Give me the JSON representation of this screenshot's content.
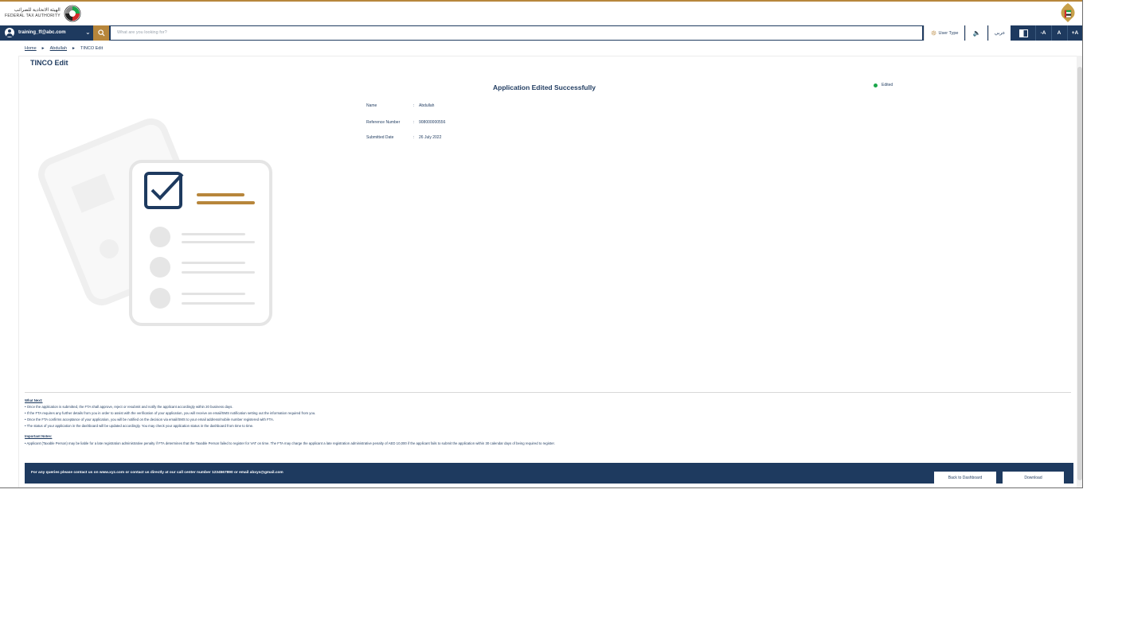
{
  "header": {
    "logo_text_ar": "الهيئة الاتحادية للضرائب",
    "logo_text_en": "FEDERAL TAX AUTHORITY"
  },
  "navbar": {
    "user_email": "training_ff@abc.com",
    "search_placeholder": "What are you looking for?",
    "user_type_label": "User Type",
    "language_label": "عربي",
    "font_decrease": "-A",
    "font_normal": "A",
    "font_increase": "+A"
  },
  "breadcrumb": {
    "items": [
      "Home",
      "Abdullah",
      "TINCO Edit"
    ]
  },
  "page": {
    "title": "TINCO Edit",
    "success_message": "Application Edited Successfully",
    "status_label": "Edited",
    "status_color": "#1aa64a"
  },
  "details": [
    {
      "label": "Name",
      "value": "Abdullah"
    },
    {
      "label": "Reference Number",
      "value": "908000000556"
    },
    {
      "label": "Submitted Date",
      "value": "26 July 2022"
    }
  ],
  "notes": {
    "what_next_heading": "What Next:",
    "what_next": [
      "• Once the application is submitted, the FTA shall approve, reject or resubmit and notify the applicant accordingly within 20 business days.",
      "• If the FTA requires any further details from you in order to assist with the verification of your application, you will receive an email/SMS notification setting out the information required from you.",
      "• Once the FTA confirms acceptance of your application, you will be notified on the decision via email/SMS to your email address/mobile number registered with FTA.",
      "• The status of your application in the dashboard will be updated accordingly. You may check your application status in the dashboard from time to time."
    ],
    "important_heading": "Important Notes:",
    "important": [
      "• Applicant (Taxable Person) may be liable for a late registration administrative penalty if FTA determines that the Taxable Person failed to register for VAT on time. The FTA may charge the applicant a late registration administrative penalty of AED 10,000 if the applicant fails to submit the application within 30 calendar days of being required to register."
    ]
  },
  "footer": {
    "contact_text": "For any queries please contact us on www.xyz.com or contact us directly at our call center number 1234567890 or email abxys@gmail.com",
    "back_button": "Back to Dashboard",
    "download_button": "Download"
  },
  "colors": {
    "primary": "#1e3a5f",
    "accent": "#b7863b"
  }
}
